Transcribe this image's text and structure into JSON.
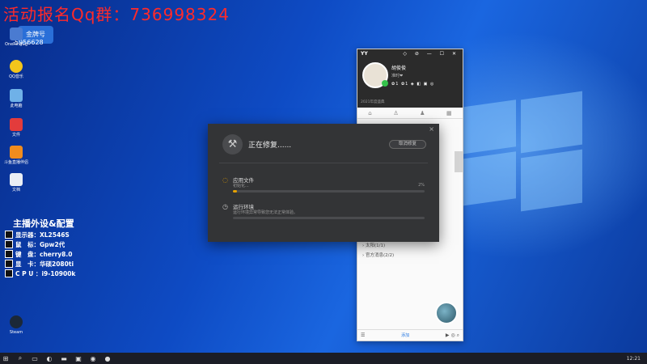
{
  "overlay": {
    "text": "活动报名Qq群：736998324"
  },
  "badge": {
    "label": "金牌号",
    "number": "5956628"
  },
  "desktop_icons": [
    {
      "label": "OneRingCg",
      "color": "#4a7bd1"
    },
    {
      "label": "QQ音乐",
      "color": "#f3c51b"
    },
    {
      "label": "此电脑",
      "color": "#6fb1e8"
    },
    {
      "label": "文件",
      "color": "#e33c3c"
    },
    {
      "label": "斗鱼直播伴侣",
      "color": "#f08c1e"
    },
    {
      "label": "文档",
      "color": "#e9eef5"
    },
    {
      "label": "Steam",
      "color": "#1b2838"
    }
  ],
  "spec": {
    "title": "主播外设&配置",
    "rows": [
      {
        "label": "显示器：",
        "value": "XL2546S"
      },
      {
        "label": "鼠　标：",
        "value": "Gpw2代"
      },
      {
        "label": "键　盘：",
        "value": "cherry8.0"
      },
      {
        "label": "显　卡：",
        "value": "华硕2080ti"
      },
      {
        "label": "C P U ：",
        "value": "i9-10900k"
      }
    ]
  },
  "yy": {
    "app_name": "YY",
    "controls": "◇ ⊘ — ☐ ✕",
    "username": "胡俊俊",
    "sub": "准时❤",
    "badges": "✿1 ✿1 ◈ ◧ ▣ ◎",
    "footer": "2021年度盛典",
    "groups": [
      "太阳(1/1)",
      "官方消息(2/2)"
    ],
    "bottom_link": "添加"
  },
  "dialog": {
    "title": "正在修复......",
    "cancel_label": "取消修复",
    "close_glyph": "×",
    "steps": [
      {
        "name": "应用文件",
        "desc": "初始化...",
        "percent": "2%",
        "progress": 0.02,
        "icon": "spinner-icon"
      },
      {
        "name": "运行环境",
        "desc": "运行环境异常导致您无法正常体验。",
        "percent": "",
        "progress": 0,
        "icon": "clock-icon"
      }
    ]
  },
  "taskbar": {
    "time": "12:21"
  }
}
